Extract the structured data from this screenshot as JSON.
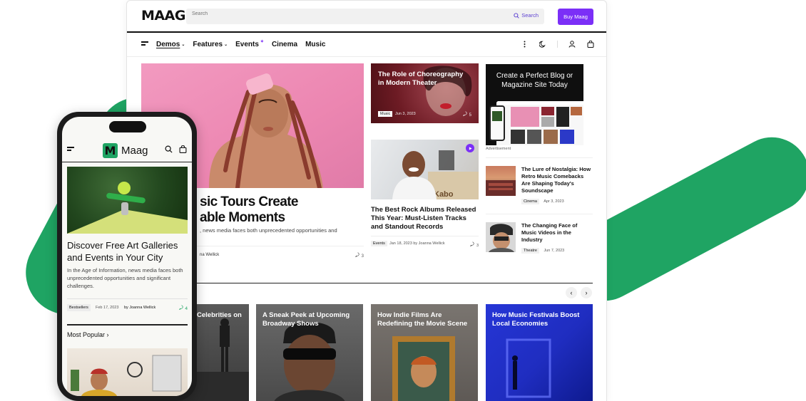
{
  "colors": {
    "accent_purple": "#7b2ff7",
    "brand_green": "#1fa463",
    "text_dark": "#111111"
  },
  "header": {
    "logo": "MAAG",
    "search_placeholder": "Search",
    "search_button": "Search",
    "buy_button": "Buy Maag"
  },
  "nav": {
    "items": [
      {
        "label": "Demos",
        "caret": "⌄"
      },
      {
        "label": "Features",
        "caret": "⌄"
      },
      {
        "label": "Events",
        "badge": "✦"
      },
      {
        "label": "Cinema"
      },
      {
        "label": "Music"
      }
    ],
    "icons": [
      "more-icon",
      "moon-icon",
      "user-icon",
      "cart-icon"
    ]
  },
  "hero": {
    "title": "sic Tours Create able Moments",
    "title_line1": "sic Tours Create",
    "title_line2": "able Moments",
    "description": ", news media faces both unprecedented opportunities and",
    "author": "na Wellick",
    "comments": "3"
  },
  "mid": {
    "card1": {
      "title": "The Role of Choreography in Modern Theater",
      "tag": "Music",
      "date": "Jun 3, 2023",
      "comments": "5"
    },
    "card2": {
      "title": "The Best Rock Albums Released This Year: Must-Listen Tracks and Standout Records",
      "tag": "Events",
      "date": "Jan 18, 2023",
      "author": "by Joanna Wellick",
      "comments": "3"
    }
  },
  "sidebar": {
    "ad": {
      "title": "Create a Perfect Blog or Magazine Site Today",
      "label": "Advertisement"
    },
    "items": [
      {
        "title": "The Lure of Nostalgia: How Retro Music Comebacks Are Shaping Today's Soundscape",
        "tag": "Cinema",
        "date": "Apr 3, 2023"
      },
      {
        "title": "The Changing Face of Music Videos in the Industry",
        "tag": "Theatre",
        "date": "Jun 7, 2023"
      }
    ]
  },
  "carousel": {
    "prev": "‹",
    "next": "›",
    "tiles": [
      {
        "title": "Celebrities on"
      },
      {
        "title": "A Sneak Peek at Upcoming Broadway Shows"
      },
      {
        "title": "How Indie Films Are Redefining the Movie Scene"
      },
      {
        "title": "How Music Festivals Boost Local Economies"
      }
    ]
  },
  "phone": {
    "logo_mark": "M",
    "logo_text": "Maag",
    "article": {
      "title": "Discover Free Art Galleries and Events in Your City",
      "description": "In the Age of Information, news media faces both unprecedented opportunities and significant challenges.",
      "tag": "Bestsellers",
      "date": "Feb 17, 2023",
      "author": "by Joanna Wellick",
      "comments": "4"
    },
    "most_popular": "Most Popular ›"
  }
}
